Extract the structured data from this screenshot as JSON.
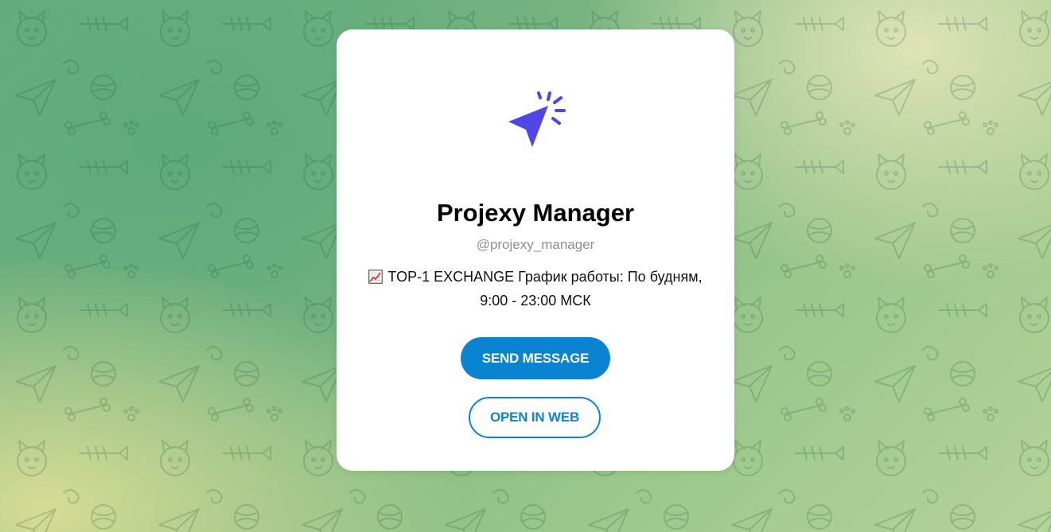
{
  "bot": {
    "name": "Projexy Manager",
    "username": "@projexy_manager",
    "description_line1": "TOP-1 EXCHANGE График работы: По будням,",
    "description_line2": "9:00 - 23:00 МСК",
    "description_icon": "chart-increasing-icon",
    "logo_icon": "cursor-click-icon"
  },
  "actions": {
    "send_message_label": "SEND MESSAGE",
    "open_in_web_label": "OPEN IN WEB"
  },
  "colors": {
    "accent": "#0a84d0",
    "logo": "#4f46e5",
    "username": "#8e8e93"
  }
}
